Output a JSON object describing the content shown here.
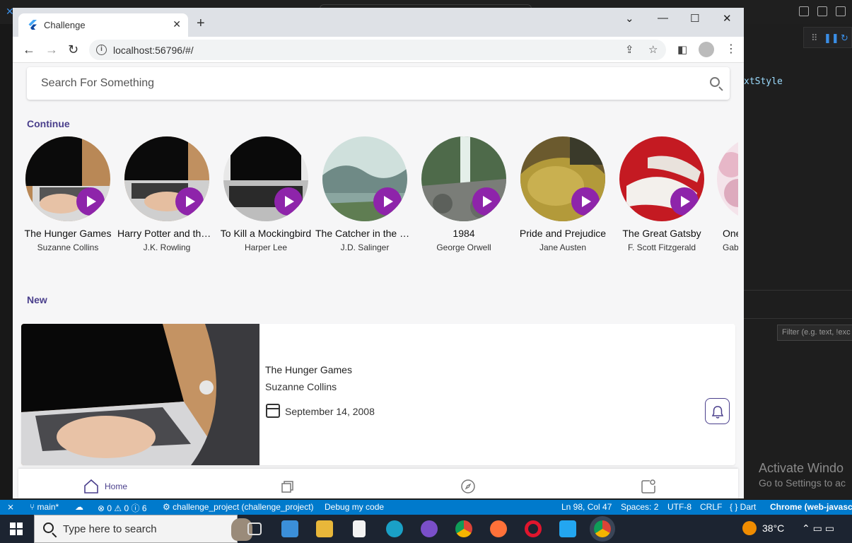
{
  "vscode": {
    "code_fragment": "xtStyle",
    "filter_placeholder": "Filter (e.g. text, !exc",
    "activate_title": "Activate Windo",
    "activate_sub": "Go to Settings to ac"
  },
  "statusbar": {
    "branch": "main*",
    "problems": "⊗ 0 ⚠ 0 ⓘ 6",
    "project": "challenge_project (challenge_project)",
    "debug": "Debug my code",
    "position": "Ln 98, Col 47",
    "spaces": "Spaces: 2",
    "encoding": "UTF-8",
    "eol": "CRLF",
    "language": "{ } Dart",
    "device": "Chrome (web-javascri"
  },
  "taskbar": {
    "search_placeholder": "Type here to search",
    "temperature": "38°C"
  },
  "browser": {
    "tab_title": "Challenge",
    "url": "localhost:56796/#/"
  },
  "app": {
    "search_placeholder": "Search For Something",
    "continue_title": "Continue",
    "new_title": "New",
    "continue_books": [
      {
        "title": "The Hunger Games",
        "author": "Suzanne Collins"
      },
      {
        "title": "Harry Potter and the ...",
        "author": "J.K. Rowling"
      },
      {
        "title": "To Kill a Mockingbird",
        "author": "Harper Lee"
      },
      {
        "title": "The Catcher in the Rye",
        "author": "J.D. Salinger"
      },
      {
        "title": "1984",
        "author": "George Orwell"
      },
      {
        "title": "Pride and Prejudice",
        "author": "Jane Austen"
      },
      {
        "title": "The Great Gatsby",
        "author": "F. Scott Fitzgerald"
      },
      {
        "title": "One H",
        "author": "Gabrie"
      }
    ],
    "new_book": {
      "title": "The Hunger Games",
      "author": "Suzanne Collins",
      "date": "September 14, 2008"
    },
    "bottom_nav": {
      "home_label": "Home"
    }
  }
}
